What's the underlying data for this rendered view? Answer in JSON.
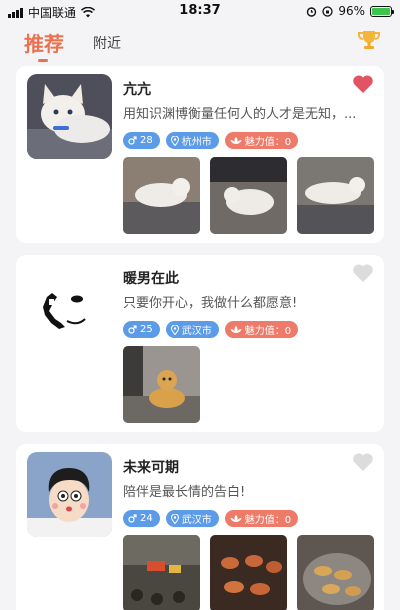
{
  "status_bar": {
    "carrier": "中国联通",
    "time": "18:37",
    "battery": "96%"
  },
  "tabs": {
    "recommend": "推荐",
    "nearby": "附近"
  },
  "cards": [
    {
      "name": "亢亢",
      "bio": "用知识渊博衡量任何人的人才是无知，...",
      "age": "28",
      "city": "杭州市",
      "charm": "魅力值：0",
      "liked": true
    },
    {
      "name": "暖男在此",
      "bio": "只要你开心，我做什么都愿意!",
      "age": "25",
      "city": "武汉市",
      "charm": "魅力值：0",
      "liked": false
    },
    {
      "name": "未来可期",
      "bio": "陪伴是最长情的告白!",
      "age": "24",
      "city": "武汉市",
      "charm": "魅力值：0",
      "liked": false
    }
  ],
  "colors": {
    "accent": "#e9724f",
    "badge_blue": "#5b9be8",
    "badge_red": "#ee7b6a",
    "heart_liked": "#e05463",
    "heart_unliked": "#dcdcdc"
  }
}
